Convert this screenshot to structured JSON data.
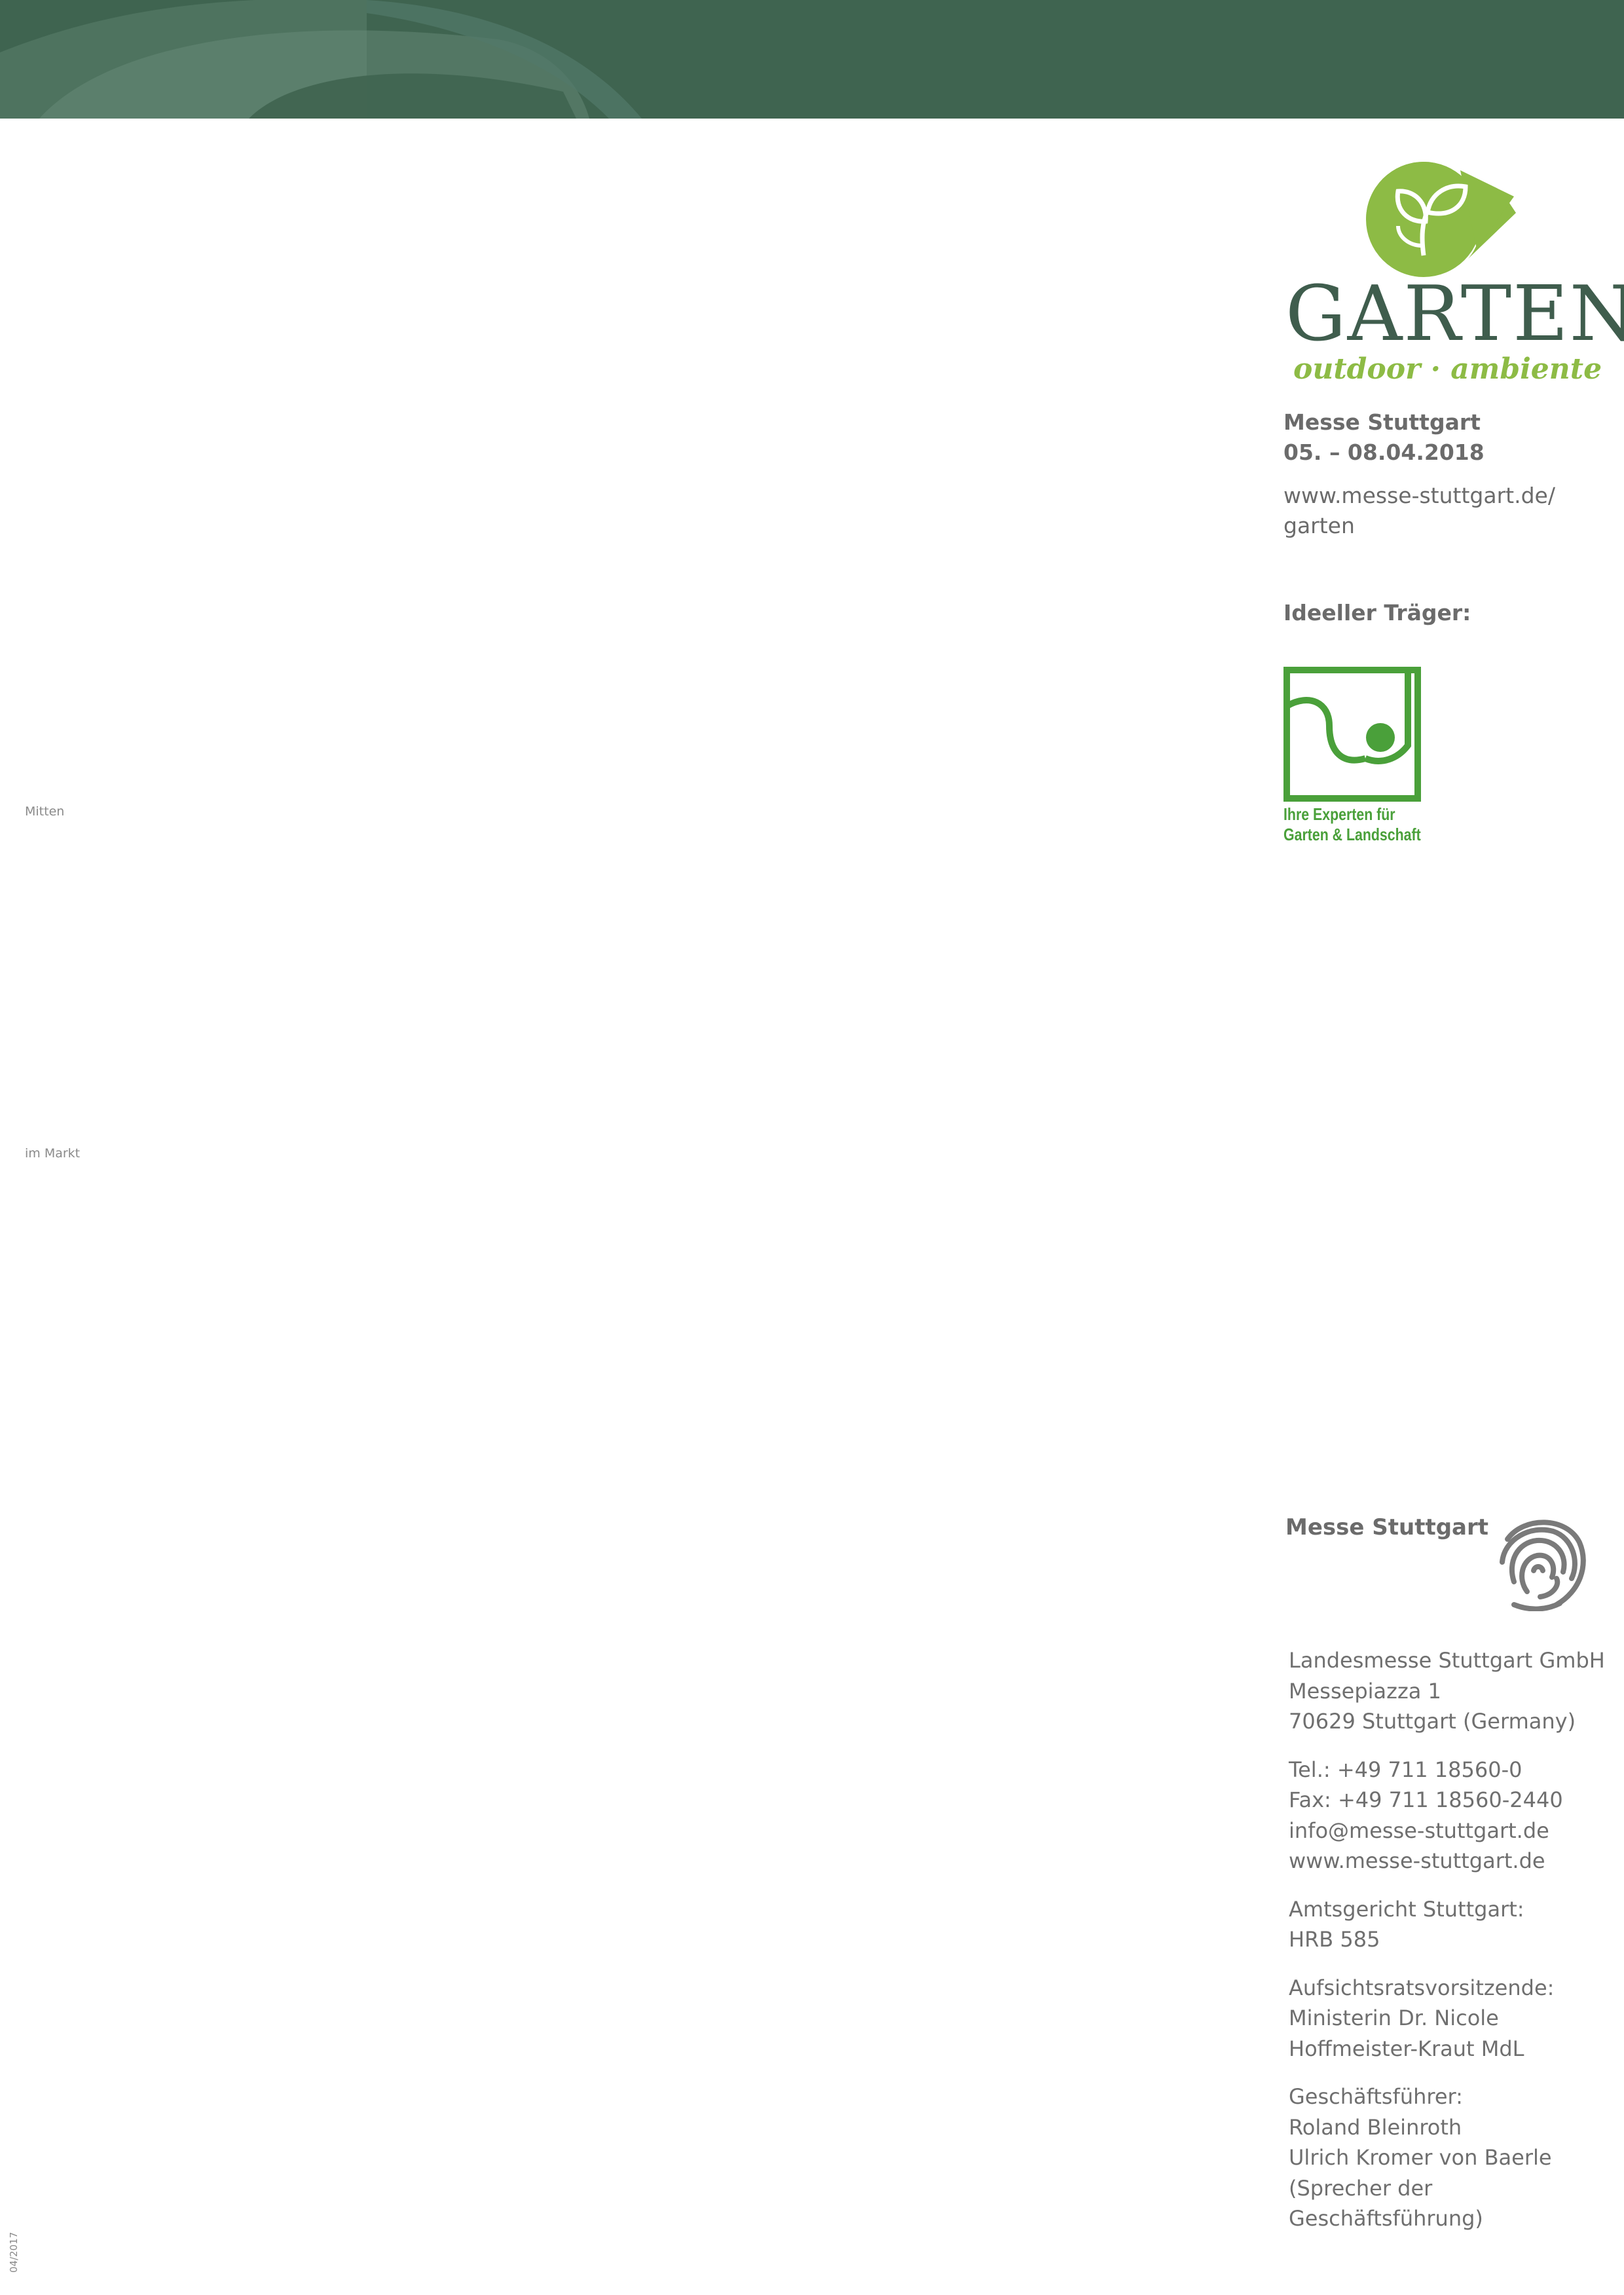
{
  "brand": {
    "colors": {
      "band": "#3f6450",
      "leaf": "#8dbb45",
      "garten": "#3f5d4d",
      "sponsor_green": "#4aa03a",
      "text_gray": "#6f6f6f"
    },
    "garten_word": "GARTEN",
    "garten_tagline": "outdoor · ambiente",
    "icons": [
      "leaf-logo-icon",
      "galabau-logo-icon",
      "messe-spiral-logo-icon"
    ]
  },
  "fair": {
    "venue": "Messe Stuttgart",
    "dates": "05. – 08.04.2018",
    "url_line1": "www.messe-stuttgart.de/",
    "url_line2": "garten"
  },
  "sponsor": {
    "label": "Ideeller Träger:",
    "logo_line1": "Ihre Experten für",
    "logo_line2": "Garten & Landschaft"
  },
  "messe": {
    "heading": "Messe Stuttgart"
  },
  "company": {
    "name": "Landesmesse Stuttgart GmbH",
    "street": "Messepiazza 1",
    "city": "70629 Stuttgart (Germany)",
    "tel": "Tel.: +49 711 18560-0",
    "fax": "Fax: +49 711 18560-2440",
    "email": "info@messe-stuttgart.de",
    "web": "www.messe-stuttgart.de",
    "court_label": "Amtsgericht Stuttgart:",
    "court_number": "HRB 585",
    "board_label": "Aufsichtsratsvorsitzende:",
    "board_line1": "Ministerin Dr. Nicole",
    "board_line2": "Hoffmeister-Kraut MdL",
    "md_label": "Geschäftsführer:",
    "md_line1": "Roland Bleinroth",
    "md_line2": "Ulrich Kromer von Baerle",
    "md_line3": "(Sprecher der",
    "md_line4": "Geschäftsführung)"
  },
  "margin_marks": {
    "fold_top": "Mitten",
    "fold_middle": "im Markt",
    "form_code": "04/2017"
  }
}
